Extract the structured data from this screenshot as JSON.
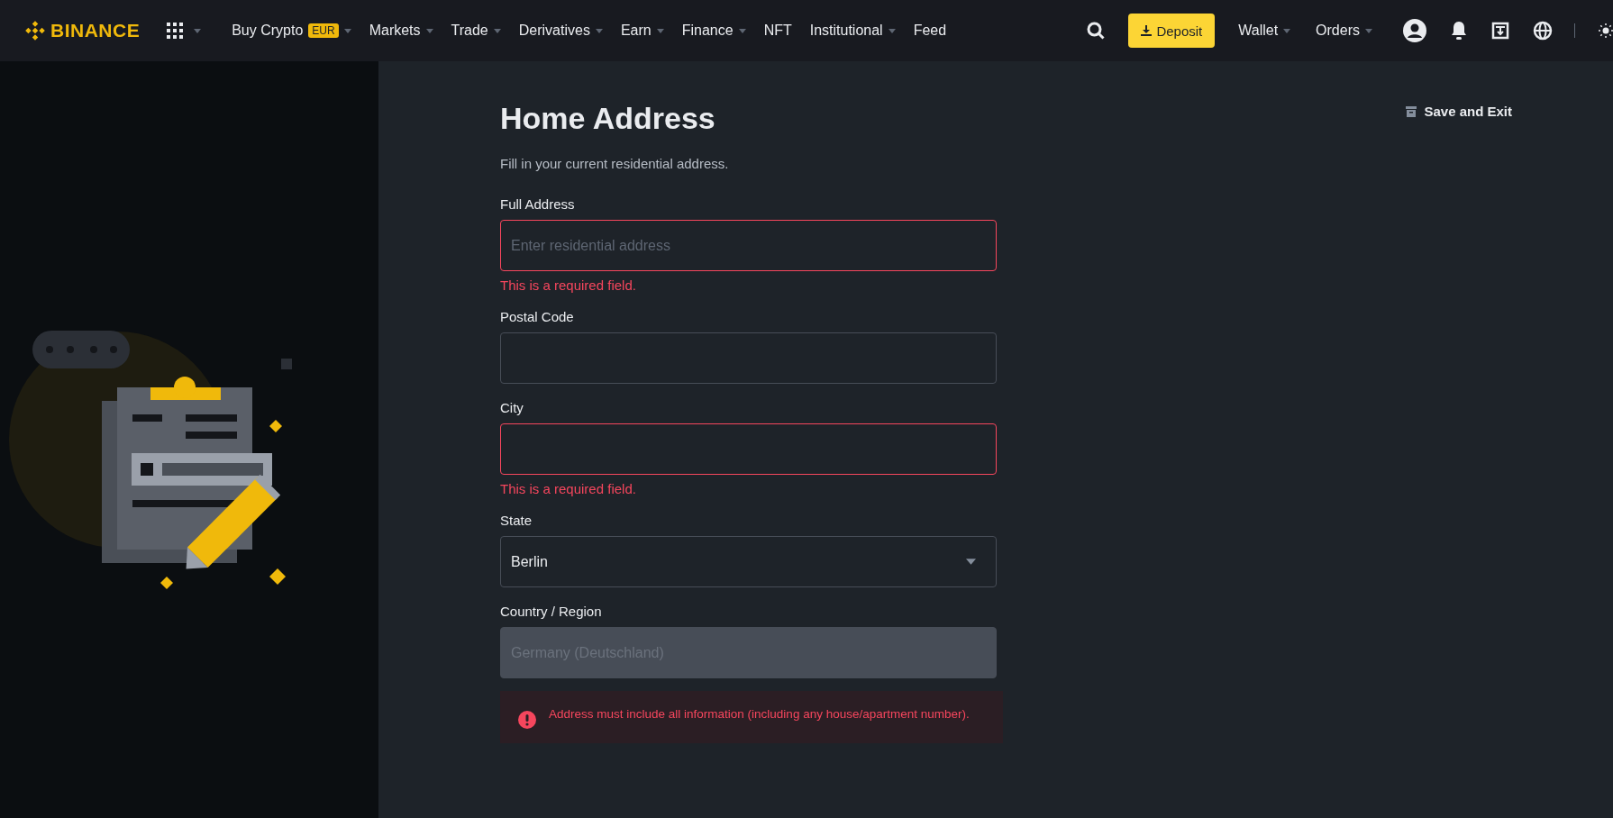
{
  "nav": {
    "logo": "BINANCE",
    "items": [
      {
        "label": "Buy Crypto",
        "badge": "EUR",
        "dropdown": true
      },
      {
        "label": "Markets",
        "dropdown": true
      },
      {
        "label": "Trade",
        "dropdown": true
      },
      {
        "label": "Derivatives",
        "dropdown": true
      },
      {
        "label": "Earn",
        "dropdown": true
      },
      {
        "label": "Finance",
        "dropdown": true
      },
      {
        "label": "NFT",
        "dropdown": false
      },
      {
        "label": "Institutional",
        "dropdown": true
      },
      {
        "label": "Feed",
        "dropdown": false
      }
    ],
    "deposit": "Deposit",
    "right_items": [
      {
        "label": "Wallet",
        "dropdown": true
      },
      {
        "label": "Orders",
        "dropdown": true
      }
    ]
  },
  "save_exit": "Save and Exit",
  "title": "Home Address",
  "subtitle": "Fill in your current residential address.",
  "fields": [
    {
      "kind": "text",
      "label": "Full Address",
      "placeholder": "Enter residential address",
      "invalid": true,
      "disabled": false,
      "error": "This is a required field."
    },
    {
      "kind": "text",
      "label": "Postal Code",
      "invalid": false,
      "disabled": false
    },
    {
      "kind": "text",
      "label": "City",
      "invalid": true,
      "disabled": false,
      "error": "This is a required field."
    },
    {
      "kind": "select",
      "label": "State",
      "value": "Berlin",
      "invalid": false,
      "disabled": false
    },
    {
      "kind": "text",
      "label": "Country / Region",
      "value": "Germany (Deutschland)",
      "invalid": false,
      "disabled": true
    }
  ],
  "alert": "Address must include all information (including any house/apartment number)."
}
